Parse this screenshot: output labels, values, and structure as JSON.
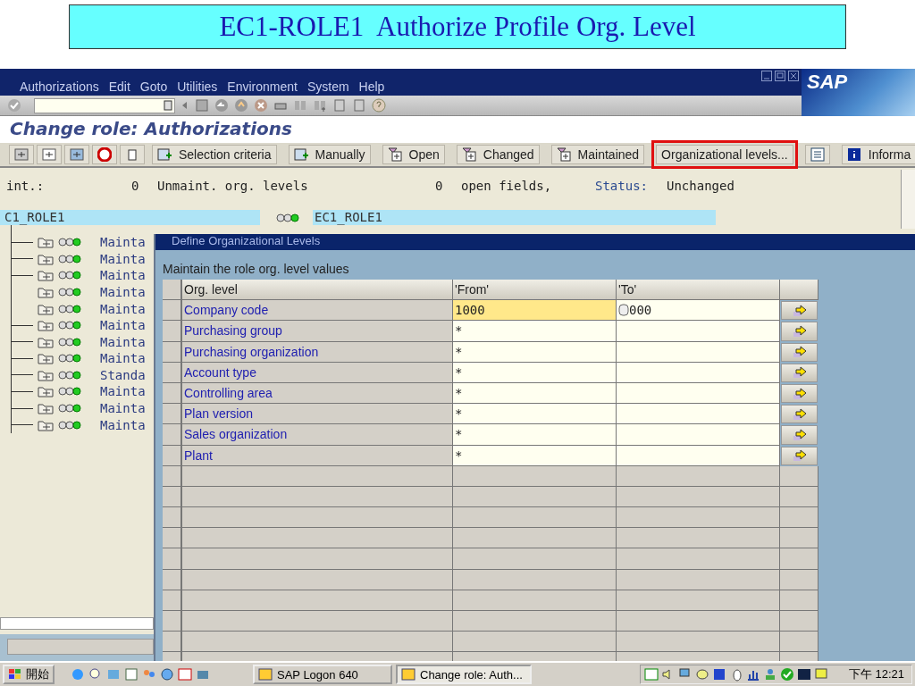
{
  "slide_title": "EC1-ROLE1  Authorize Profile Org. Level",
  "window": {
    "menu": [
      "Authorizations",
      "Edit",
      "Goto",
      "Utilities",
      "Environment",
      "System",
      "Help"
    ],
    "logo": "SAP",
    "title": "Change role: Authorizations"
  },
  "app_toolbar": [
    {
      "kind": "add",
      "label": "Selection criteria",
      "highlighted": false
    },
    {
      "kind": "add",
      "label": "Manually",
      "highlighted": false
    },
    {
      "kind": "filter",
      "label": "Open",
      "highlighted": false
    },
    {
      "kind": "filter",
      "label": "Changed",
      "highlighted": false
    },
    {
      "kind": "filter",
      "label": "Maintained",
      "highlighted": false
    },
    {
      "kind": "plain",
      "label": "Organizational levels...",
      "highlighted": true
    },
    {
      "kind": "list",
      "highlighted": false
    },
    {
      "kind": "info",
      "label": "Informa",
      "highlighted": false
    }
  ],
  "summary": [
    {
      "kind": "label",
      "text": "int.:"
    },
    {
      "kind": "value",
      "text": "0"
    },
    {
      "kind": "label",
      "text": "Unmaint. org. levels"
    },
    {
      "kind": "value",
      "text": "0"
    },
    {
      "kind": "label",
      "text": "open fields,"
    },
    {
      "kind": "key",
      "text": "Status:"
    },
    {
      "kind": "value",
      "text": "Unchanged"
    }
  ],
  "role_row": {
    "left": "C1_ROLE1",
    "right": "EC1_ROLE1"
  },
  "tree": [
    {
      "text": "Mainta",
      "connector": true
    },
    {
      "text": "Mainta",
      "connector": true
    },
    {
      "text": "Mainta",
      "connector": true
    },
    {
      "text": "Mainta",
      "connector": false
    },
    {
      "text": "Mainta",
      "connector": false
    },
    {
      "text": "Mainta",
      "connector": true
    },
    {
      "text": "Mainta",
      "connector": true
    },
    {
      "text": "Mainta",
      "connector": true
    },
    {
      "text": "Standa",
      "connector": true
    },
    {
      "text": "Mainta",
      "connector": true
    },
    {
      "text": "Mainta",
      "connector": true
    },
    {
      "text": "Mainta",
      "connector": true
    }
  ],
  "dialog": {
    "title": "Define Organizational Levels",
    "instruction": "Maintain the role org. level values",
    "columns": [
      "Org. level",
      "'From'",
      "'To'"
    ],
    "rows": [
      {
        "org_level": "Company code",
        "from": "1000",
        "to": "000",
        "focused": true
      },
      {
        "org_level": "Purchasing group",
        "from": "*",
        "focused": false
      },
      {
        "org_level": "Purchasing organization",
        "from": "*",
        "focused": false
      },
      {
        "org_level": "Account type",
        "from": "*",
        "focused": false
      },
      {
        "org_level": "Controlling area",
        "from": "*",
        "focused": false
      },
      {
        "org_level": "Plan version",
        "from": "*",
        "focused": false
      },
      {
        "org_level": "Sales organization",
        "from": "*",
        "focused": false
      },
      {
        "org_level": "Plant",
        "from": "*",
        "focused": false
      }
    ]
  },
  "taskbar": {
    "start": "開始",
    "tasks": [
      {
        "label": "SAP Logon 640",
        "selected": false
      },
      {
        "label": "Change role: Auth...",
        "selected": true
      }
    ],
    "clock": "下午 12:21"
  }
}
